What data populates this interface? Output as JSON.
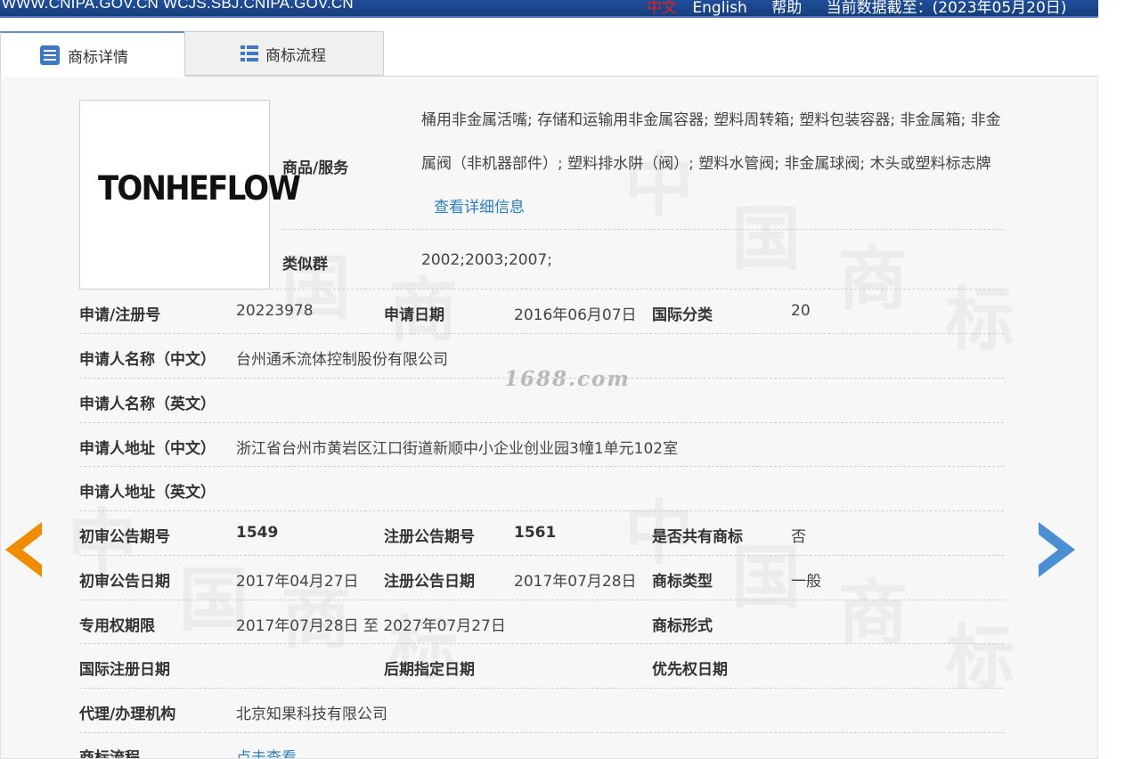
{
  "topbar": {
    "site": "WWW.CNIPA.GOV.CN WCJS.SBJ.CNIPA.GOV.CN",
    "lang_cn": "中文",
    "lang_en": "English",
    "help": "帮助",
    "data_date": "当前数据截至：(2023年05月20日)"
  },
  "tabs": [
    {
      "label": "商标详情",
      "icon": "detail-list-icon"
    },
    {
      "label": "商标流程",
      "icon": "flow-list-icon"
    }
  ],
  "logo": {
    "text": "TONHEFLOW"
  },
  "watermark": {
    "site": "1688.com",
    "chars": [
      "中",
      "国",
      "商",
      "标"
    ]
  },
  "goods": {
    "label": "商品/服务",
    "text": "桶用非金属活嘴; 存储和运输用非金属容器; 塑料周转箱; 塑料包装容器; 非金属箱; 非金属阀（非机器部件）; 塑料排水阱（阀）; 塑料水管阀; 非金属球阀; 木头或塑料标志牌",
    "link": "查看详细信息"
  },
  "similar_group": {
    "label": "类似群",
    "value": "2002;2003;2007;"
  },
  "fields": {
    "reg_no": {
      "label": "申请/注册号",
      "value": "20223978"
    },
    "app_date": {
      "label": "申请日期",
      "value": "2016年06月07日"
    },
    "intl_class": {
      "label": "国际分类",
      "value": "20"
    },
    "applicant_cn": {
      "label": "申请人名称（中文）",
      "value": "台州通禾流体控制股份有限公司"
    },
    "applicant_en": {
      "label": "申请人名称（英文）",
      "value": ""
    },
    "address_cn": {
      "label": "申请人地址（中文）",
      "value": "浙江省台州市黄岩区江口街道新顺中小企业创业园3幢1单元102室"
    },
    "address_en": {
      "label": "申请人地址（英文）",
      "value": ""
    },
    "prelim_issue": {
      "label": "初审公告期号",
      "value": "1549"
    },
    "reg_issue": {
      "label": "注册公告期号",
      "value": "1561"
    },
    "shared": {
      "label": "是否共有商标",
      "value": "否"
    },
    "prelim_date": {
      "label": "初审公告日期",
      "value": "2017年04月27日"
    },
    "reg_date": {
      "label": "注册公告日期",
      "value": "2017年07月28日"
    },
    "tm_type": {
      "label": "商标类型",
      "value": "一般"
    },
    "exclusive_period": {
      "label": "专用权期限",
      "value": "2017年07月28日 至 2027年07月27日"
    },
    "tm_form": {
      "label": "商标形式",
      "value": ""
    },
    "intl_reg_date": {
      "label": "国际注册日期",
      "value": ""
    },
    "later_designation": {
      "label": "后期指定日期",
      "value": ""
    },
    "priority_date": {
      "label": "优先权日期",
      "value": ""
    },
    "agent": {
      "label": "代理/办理机构",
      "value": "北京知果科技有限公司"
    },
    "flow": {
      "label": "商标流程",
      "value": "点击查看"
    }
  },
  "colors": {
    "topbar": "#1f4e9a",
    "link": "#2a7fc3",
    "arrow_left": "#f08c00",
    "arrow_right": "#4a8fd4"
  }
}
